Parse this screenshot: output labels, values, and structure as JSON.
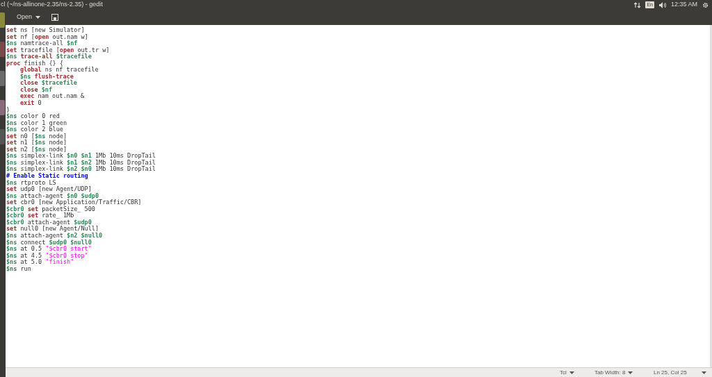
{
  "window": {
    "title": "cl (~/ns-allinone-2.35/ns-2.35) - gedit"
  },
  "indicators": {
    "keyboard": "En",
    "clock": "12:35 AM"
  },
  "toolbar": {
    "open_button": "Open"
  },
  "editor": {
    "lines": [
      {
        "tokens": [
          {
            "kind": "kw",
            "text": "set"
          },
          {
            "kind": "plain",
            "text": " ns [new Simulator]"
          }
        ]
      },
      {
        "tokens": [
          {
            "kind": "kw",
            "text": "set"
          },
          {
            "kind": "plain",
            "text": " nf ["
          },
          {
            "kind": "kw",
            "text": "open"
          },
          {
            "kind": "plain",
            "text": " out.nam w]"
          }
        ]
      },
      {
        "tokens": [
          {
            "kind": "var",
            "text": "$ns"
          },
          {
            "kind": "plain",
            "text": " namtrace-all "
          },
          {
            "kind": "var",
            "text": "$nf"
          }
        ]
      },
      {
        "tokens": [
          {
            "kind": "kw",
            "text": "set"
          },
          {
            "kind": "plain",
            "text": " tracefile ["
          },
          {
            "kind": "kw",
            "text": "open"
          },
          {
            "kind": "plain",
            "text": " out.tr w]"
          }
        ]
      },
      {
        "tokens": [
          {
            "kind": "var",
            "text": "$ns"
          },
          {
            "kind": "kw",
            "text": " trace-all"
          },
          {
            "kind": "var",
            "text": " $tracefile"
          }
        ]
      },
      {
        "tokens": [
          {
            "kind": "kw",
            "text": "proc"
          },
          {
            "kind": "plain",
            "text": " finish {} {"
          }
        ]
      },
      {
        "indented": true,
        "tokens": [
          {
            "kind": "kw",
            "text": "global"
          },
          {
            "kind": "plain",
            "text": " ns nf tracefile"
          }
        ]
      },
      {
        "indented": true,
        "tokens": [
          {
            "kind": "var",
            "text": "$ns"
          },
          {
            "kind": "kw",
            "text": " flush-trace"
          }
        ]
      },
      {
        "indented": true,
        "tokens": [
          {
            "kind": "kw",
            "text": "close"
          },
          {
            "kind": "var",
            "text": " $tracefile"
          }
        ]
      },
      {
        "indented": true,
        "tokens": [
          {
            "kind": "kw",
            "text": "close"
          },
          {
            "kind": "var",
            "text": " $nf"
          }
        ]
      },
      {
        "indented": true,
        "tokens": [
          {
            "kind": "kw",
            "text": "exec"
          },
          {
            "kind": "plain",
            "text": " nam out.nam &"
          }
        ]
      },
      {
        "indented": true,
        "tokens": [
          {
            "kind": "kw",
            "text": "exit"
          },
          {
            "kind": "plain",
            "text": " 0"
          }
        ]
      },
      {
        "tokens": [
          {
            "kind": "plain",
            "text": "}"
          }
        ]
      },
      {
        "tokens": [
          {
            "kind": "var",
            "text": "$ns"
          },
          {
            "kind": "plain",
            "text": " color 0 red"
          }
        ]
      },
      {
        "tokens": [
          {
            "kind": "var",
            "text": "$ns"
          },
          {
            "kind": "plain",
            "text": " color 1 green"
          }
        ]
      },
      {
        "tokens": [
          {
            "kind": "var",
            "text": "$ns"
          },
          {
            "kind": "plain",
            "text": " color 2 blue"
          }
        ]
      },
      {
        "tokens": [
          {
            "kind": "kw",
            "text": "set"
          },
          {
            "kind": "plain",
            "text": " n0 ["
          },
          {
            "kind": "var",
            "text": "$ns"
          },
          {
            "kind": "plain",
            "text": " node]"
          }
        ]
      },
      {
        "tokens": [
          {
            "kind": "kw",
            "text": "set"
          },
          {
            "kind": "plain",
            "text": " n1 ["
          },
          {
            "kind": "var",
            "text": "$ns"
          },
          {
            "kind": "plain",
            "text": " node]"
          }
        ]
      },
      {
        "tokens": [
          {
            "kind": "kw",
            "text": "set"
          },
          {
            "kind": "plain",
            "text": " n2 ["
          },
          {
            "kind": "var",
            "text": "$ns"
          },
          {
            "kind": "plain",
            "text": " node]"
          }
        ]
      },
      {
        "tokens": [
          {
            "kind": "var",
            "text": "$ns"
          },
          {
            "kind": "plain",
            "text": " simplex-link "
          },
          {
            "kind": "var",
            "text": "$n0"
          },
          {
            "kind": "var",
            "text": " $n1"
          },
          {
            "kind": "plain",
            "text": " 1Mb 10ms DropTail"
          }
        ]
      },
      {
        "tokens": [
          {
            "kind": "var",
            "text": "$ns"
          },
          {
            "kind": "plain",
            "text": " simplex-link "
          },
          {
            "kind": "var",
            "text": "$n1"
          },
          {
            "kind": "var",
            "text": " $n2"
          },
          {
            "kind": "plain",
            "text": " 1Mb 10ms DropTail"
          }
        ]
      },
      {
        "tokens": [
          {
            "kind": "var",
            "text": "$ns"
          },
          {
            "kind": "plain",
            "text": " simplex-link "
          },
          {
            "kind": "var",
            "text": "$n2"
          },
          {
            "kind": "var",
            "text": " $n0"
          },
          {
            "kind": "plain",
            "text": " 1Mb 10ms DropTail"
          }
        ]
      },
      {
        "tokens": [
          {
            "kind": "comment",
            "text": "# Enable Static routing"
          }
        ]
      },
      {
        "tokens": [
          {
            "kind": "var",
            "text": "$ns"
          },
          {
            "kind": "plain",
            "text": " rtproto LS"
          }
        ]
      },
      {
        "tokens": [
          {
            "kind": "kw",
            "text": "set"
          },
          {
            "kind": "plain",
            "text": " udp0 [new Agent/UDP]"
          }
        ]
      },
      {
        "tokens": [
          {
            "kind": "var",
            "text": "$ns"
          },
          {
            "kind": "plain",
            "text": " attach-agent "
          },
          {
            "kind": "var",
            "text": "$n0"
          },
          {
            "kind": "var",
            "text": " $udp0"
          }
        ]
      },
      {
        "tokens": [
          {
            "kind": "kw",
            "text": "set"
          },
          {
            "kind": "plain",
            "text": " cbr0 [new Application/Traffic/CBR]"
          }
        ]
      },
      {
        "tokens": [
          {
            "kind": "var",
            "text": "$cbr0"
          },
          {
            "kind": "kw",
            "text": " set"
          },
          {
            "kind": "plain",
            "text": " packetSize_ 500"
          }
        ]
      },
      {
        "tokens": [
          {
            "kind": "var",
            "text": "$cbr0"
          },
          {
            "kind": "kw",
            "text": " set"
          },
          {
            "kind": "plain",
            "text": " rate_ 1Mb"
          }
        ]
      },
      {
        "tokens": [
          {
            "kind": "var",
            "text": "$cbr0"
          },
          {
            "kind": "plain",
            "text": " attach-agent "
          },
          {
            "kind": "var",
            "text": "$udp0"
          }
        ]
      },
      {
        "tokens": [
          {
            "kind": "kw",
            "text": "set"
          },
          {
            "kind": "plain",
            "text": " null0 [new Agent/Null]"
          }
        ]
      },
      {
        "tokens": [
          {
            "kind": "var",
            "text": "$ns"
          },
          {
            "kind": "plain",
            "text": " attach-agent "
          },
          {
            "kind": "var",
            "text": "$n2"
          },
          {
            "kind": "var",
            "text": " $null0"
          }
        ]
      },
      {
        "tokens": [
          {
            "kind": "var",
            "text": "$ns"
          },
          {
            "kind": "plain",
            "text": " connect "
          },
          {
            "kind": "var",
            "text": "$udp0"
          },
          {
            "kind": "var",
            "text": " $null0"
          }
        ]
      },
      {
        "tokens": [
          {
            "kind": "var",
            "text": "$ns"
          },
          {
            "kind": "plain",
            "text": " at 0.5 "
          },
          {
            "kind": "string",
            "text": "\"$cbr0 start\""
          }
        ]
      },
      {
        "tokens": [
          {
            "kind": "var",
            "text": "$ns"
          },
          {
            "kind": "plain",
            "text": " at 4.5 "
          },
          {
            "kind": "string",
            "text": "\"$cbr0 stop\""
          }
        ]
      },
      {
        "tokens": [
          {
            "kind": "var",
            "text": "$ns"
          },
          {
            "kind": "plain",
            "text": " at 5.0 "
          },
          {
            "kind": "string",
            "text": "\"finish\""
          }
        ]
      },
      {
        "tokens": [
          {
            "kind": "var",
            "text": "$ns"
          },
          {
            "kind": "plain",
            "text": " run"
          }
        ]
      }
    ]
  },
  "status_bar": {
    "language": "Tcl",
    "tab_width": "Tab Width: 8",
    "position": "Ln 25, Col 25"
  }
}
